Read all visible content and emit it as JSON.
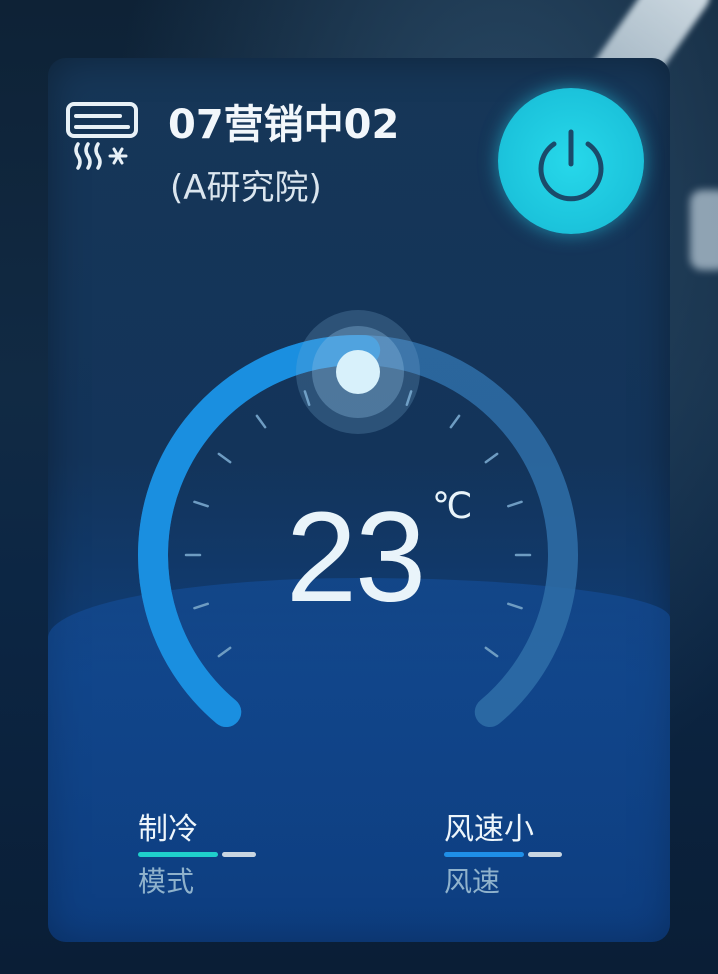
{
  "device": {
    "name": "07营销中02",
    "location": "(A研究院)",
    "icon": "air-conditioner-icon"
  },
  "power": {
    "icon": "power-icon",
    "state": "on",
    "color": "#1fd0e4"
  },
  "thermostat": {
    "temperature": "23",
    "unit": "℃",
    "arc_color": "#1a8fe0",
    "track_color": "#2f6ea8"
  },
  "controls": {
    "mode": {
      "value": "制冷",
      "label": "模式",
      "accent": "#1fd0cc"
    },
    "fan": {
      "value": "风速小",
      "label": "风速",
      "accent": "#1f8fe8"
    }
  }
}
